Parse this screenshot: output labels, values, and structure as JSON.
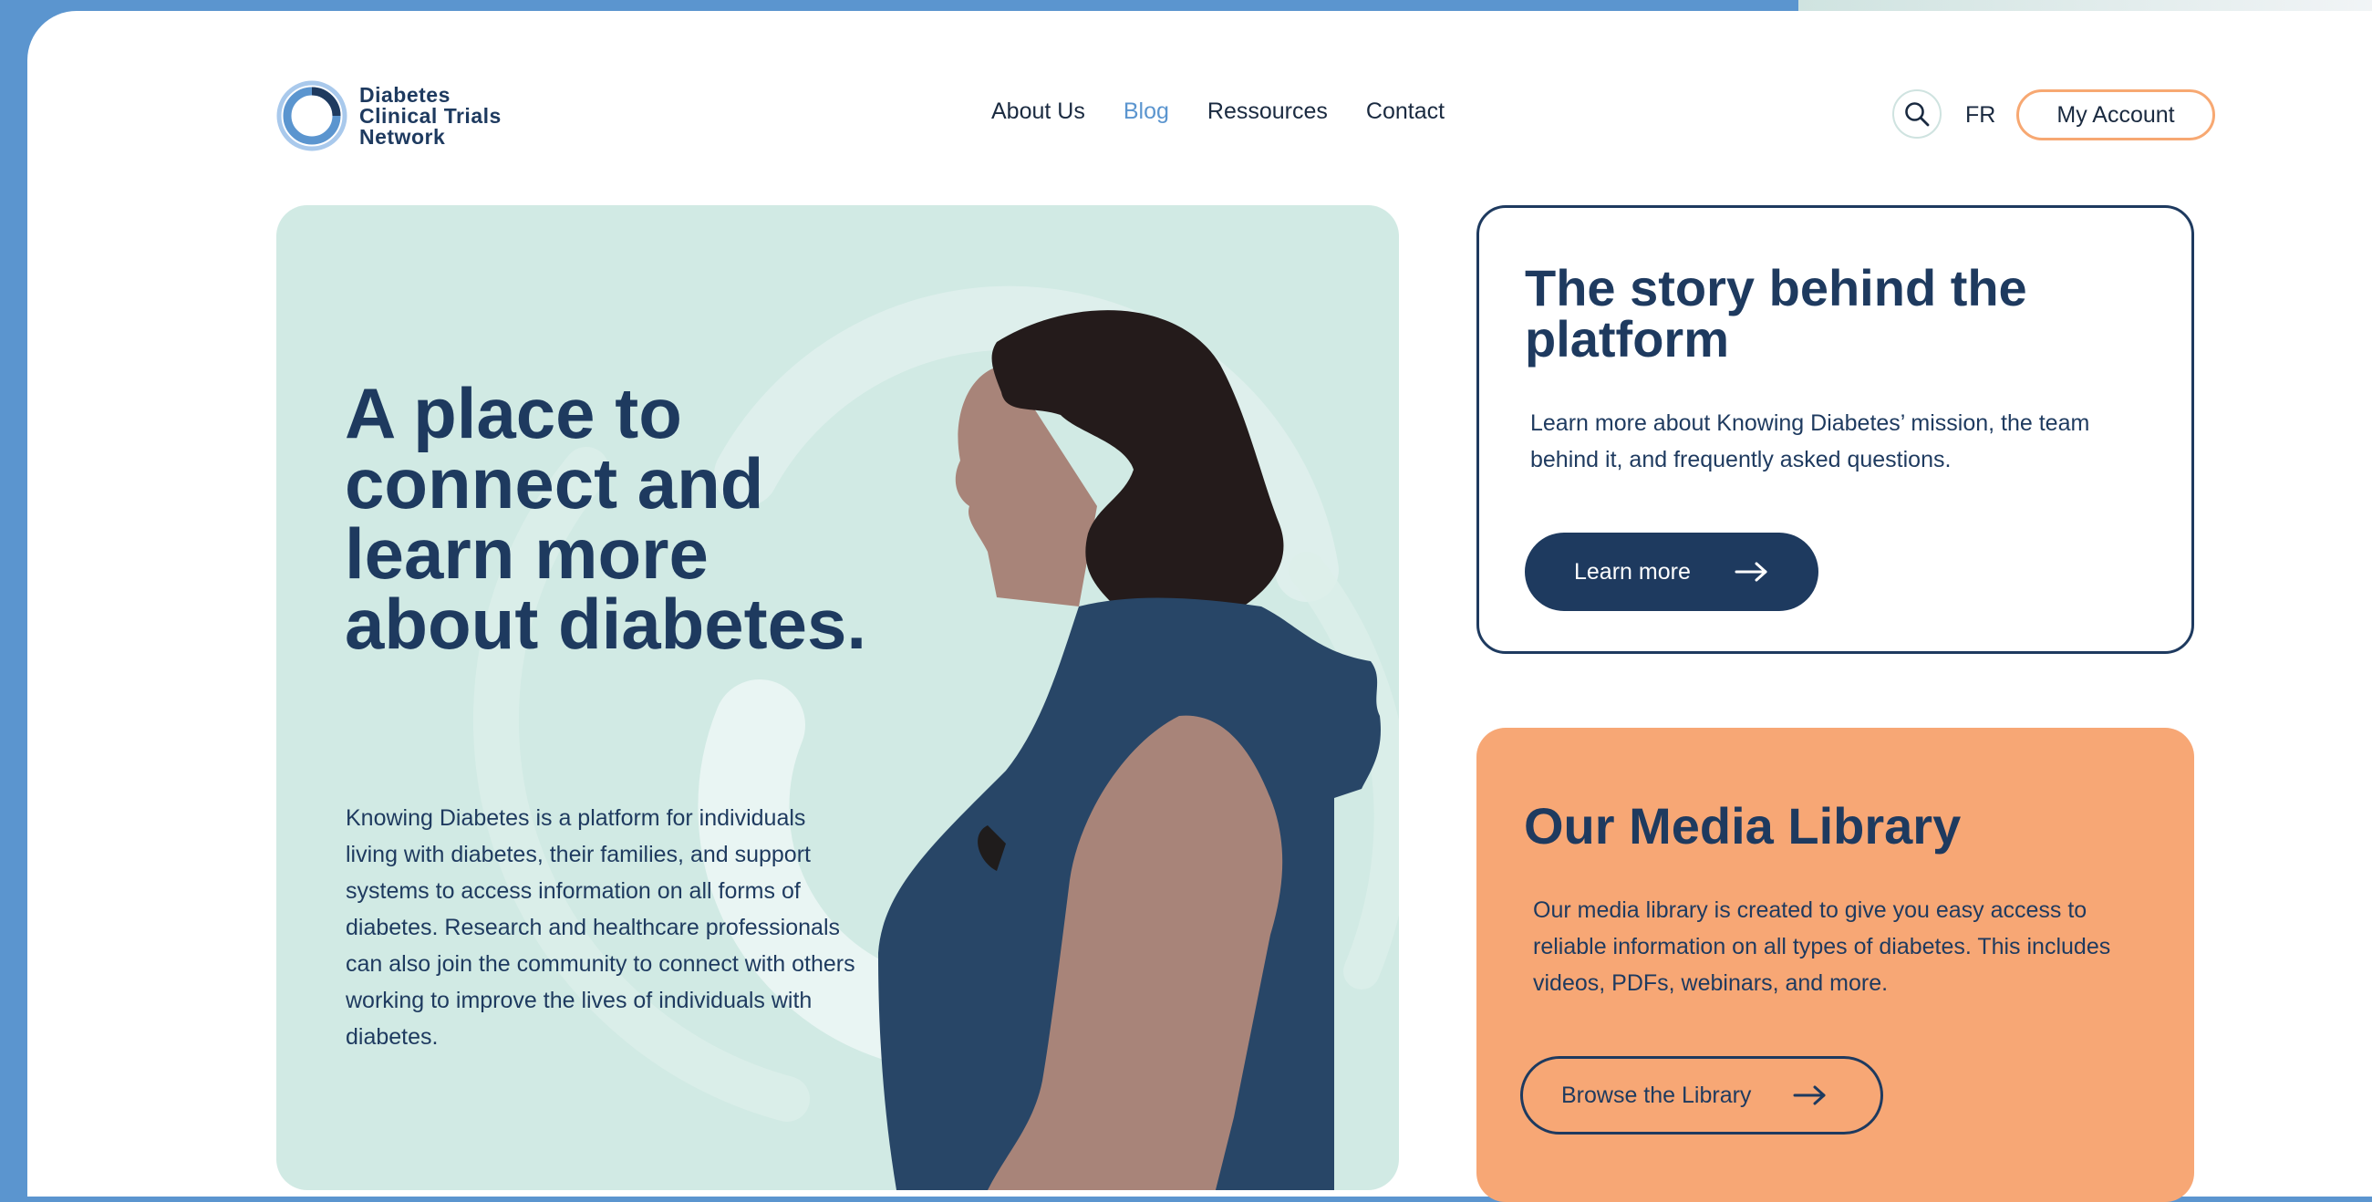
{
  "brand": {
    "logo_line1": "Diabetes",
    "logo_line2": "Clinical Trials",
    "logo_line3": "Network",
    "color_primary": "#1e3a5f",
    "color_accent": "#5b95cf",
    "color_orange": "#f7a775",
    "color_mint": "#d1eae4"
  },
  "nav": {
    "items": [
      {
        "label": "About Us",
        "active": false
      },
      {
        "label": "Blog",
        "active": true
      },
      {
        "label": "Ressources",
        "active": false
      },
      {
        "label": "Contact",
        "active": false
      }
    ]
  },
  "header": {
    "search_icon": "search-icon",
    "language": "FR",
    "account_label": "My Account"
  },
  "hero": {
    "title_line1": "A place to",
    "title_line2": "connect and",
    "title_line3": "learn more",
    "title_line4": "about diabetes.",
    "body": "Knowing Diabetes is a platform for individuals living with diabetes, their families, and support systems to access information on all forms of diabetes. Research and healthcare professionals can also join the community to connect with others working to improve the lives of individuals with diabetes."
  },
  "story": {
    "title": "The story behind the platform",
    "body": "Learn more about Knowing Diabetes’ mission, the team behind it, and frequently asked questions.",
    "button_label": "Learn more",
    "button_icon": "arrow-right-icon"
  },
  "media": {
    "title": "Our Media Library",
    "body": "Our media library is created to give you easy access to reliable information on all types of diabetes. This includes videos, PDFs, webinars, and more.",
    "button_label": "Browse the Library",
    "button_icon": "arrow-right-icon"
  }
}
